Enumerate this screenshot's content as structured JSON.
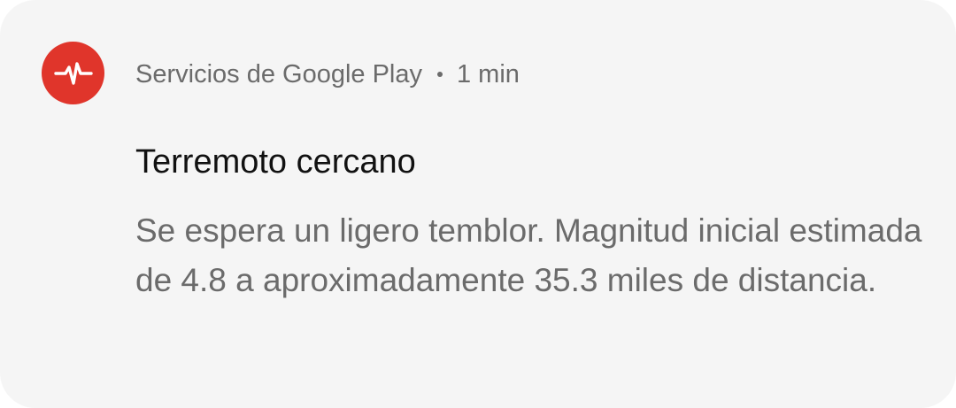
{
  "notification": {
    "app_name": "Servicios de Google Play",
    "time": "1 min",
    "title": "Terremoto cercano",
    "message": "Se espera un ligero temblor. Magnitud inicial estimada de 4.8 a aproximadamente 35.3 miles de distancia.",
    "icon": "earthquake-pulse-icon",
    "icon_color": "#e0352b"
  }
}
